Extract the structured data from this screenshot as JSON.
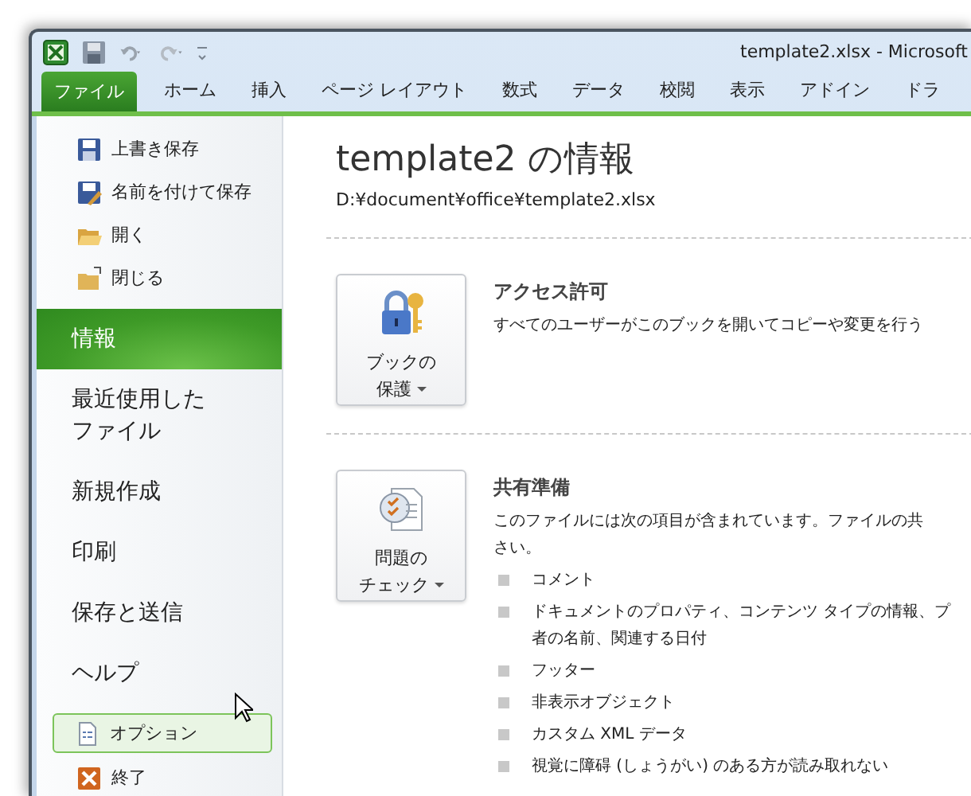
{
  "window": {
    "title": "template2.xlsx  -  Microsoft"
  },
  "ribbon_tabs": [
    {
      "label": "ファイル",
      "selected": true
    },
    {
      "label": "ホーム",
      "selected": false
    },
    {
      "label": "挿入",
      "selected": false
    },
    {
      "label": "ページ レイアウト",
      "selected": false
    },
    {
      "label": "数式",
      "selected": false
    },
    {
      "label": "データ",
      "selected": false
    },
    {
      "label": "校閲",
      "selected": false
    },
    {
      "label": "表示",
      "selected": false
    },
    {
      "label": "アドイン",
      "selected": false
    },
    {
      "label": "ドラ",
      "selected": false
    }
  ],
  "sidebar": {
    "items": [
      {
        "kind": "command",
        "label": "上書き保存",
        "selected": false,
        "hovered": false
      },
      {
        "kind": "command",
        "label": "名前を付けて保存",
        "selected": false,
        "hovered": false
      },
      {
        "kind": "command",
        "label": "開く",
        "selected": false,
        "hovered": false
      },
      {
        "kind": "command",
        "label": "閉じる",
        "selected": false,
        "hovered": false
      },
      {
        "kind": "section",
        "label": "情報",
        "selected": true
      },
      {
        "kind": "section",
        "label": "最近使用したファイル",
        "selected": false
      },
      {
        "kind": "section",
        "label": "新規作成",
        "selected": false
      },
      {
        "kind": "section",
        "label": "印刷",
        "selected": false
      },
      {
        "kind": "section",
        "label": "保存と送信",
        "selected": false
      },
      {
        "kind": "section",
        "label": "ヘルプ",
        "selected": false
      },
      {
        "kind": "command",
        "label": "オプション",
        "selected": false,
        "hovered": true
      },
      {
        "kind": "command",
        "label": "終了",
        "selected": false,
        "hovered": false
      }
    ]
  },
  "info": {
    "title": "template2 の情報",
    "path": "D:¥document¥office¥template2.xlsx",
    "sections": [
      {
        "button_lines": [
          "ブックの",
          "保護"
        ],
        "title": "アクセス許可",
        "description_lines": [
          "すべてのユーザーがこのブックを開いてコピーや変更を行う"
        ]
      },
      {
        "button_lines": [
          "問題の",
          "チェック"
        ],
        "title": "共有準備",
        "description_lines": [
          "このファイルには次の項目が含まれています。ファイルの共",
          "さい。"
        ],
        "bullets": [
          {
            "lines": [
              "コメント"
            ]
          },
          {
            "lines": [
              "ドキュメントのプロパティ、コンテンツ タイプの情報、プ",
              "者の名前、関連する日付"
            ]
          },
          {
            "lines": [
              "フッター"
            ]
          },
          {
            "lines": [
              "非表示オブジェクト"
            ]
          },
          {
            "lines": [
              "カスタム XML データ"
            ]
          },
          {
            "lines": [
              "視覚に障碍 (しょうがい) のある方が読み取れない"
            ]
          }
        ]
      }
    ]
  }
}
